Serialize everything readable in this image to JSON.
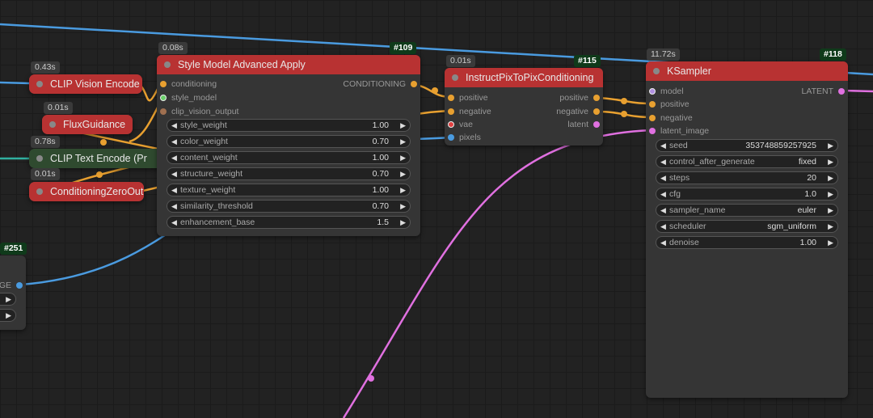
{
  "nodes": {
    "clip_vision_encode": {
      "title": "CLIP Vision Encode",
      "timing": "0.43s"
    },
    "flux_guidance": {
      "title": "FluxGuidance",
      "timing": "0.01s"
    },
    "clip_text_encode": {
      "title": "CLIP Text Encode (Pr",
      "timing": "0.78s"
    },
    "conditioning_zero_out": {
      "title": "ConditioningZeroOut",
      "timing": "0.01s"
    },
    "style_model": {
      "id": "#109",
      "title": "Style Model Advanced Apply",
      "timing": "0.08s",
      "inputs": [
        "conditioning",
        "style_model",
        "clip_vision_output"
      ],
      "output": "CONDITIONING",
      "widgets": [
        {
          "label": "style_weight",
          "value": "1.00"
        },
        {
          "label": "color_weight",
          "value": "0.70"
        },
        {
          "label": "content_weight",
          "value": "1.00"
        },
        {
          "label": "structure_weight",
          "value": "0.70"
        },
        {
          "label": "texture_weight",
          "value": "1.00"
        },
        {
          "label": "similarity_threshold",
          "value": "0.70"
        },
        {
          "label": "enhancement_base",
          "value": "1.5"
        }
      ]
    },
    "instruct_pix": {
      "id": "#115",
      "title": "InstructPixToPixConditioning",
      "timing": "0.01s",
      "inputs": [
        "positive",
        "negative",
        "vae",
        "pixels"
      ],
      "outputs": [
        "positive",
        "negative",
        "latent"
      ]
    },
    "ksampler": {
      "id": "#118",
      "title": "KSampler",
      "timing": "11.72s",
      "inputs": [
        "model",
        "positive",
        "negative",
        "latent_image"
      ],
      "output": "LATENT",
      "widgets": [
        {
          "label": "seed",
          "value": "353748859257925"
        },
        {
          "label": "control_after_generate",
          "value": "fixed"
        },
        {
          "label": "steps",
          "value": "20"
        },
        {
          "label": "cfg",
          "value": "1.0"
        },
        {
          "label": "sampler_name",
          "value": "euler"
        },
        {
          "label": "scheduler",
          "value": "sgm_uniform"
        },
        {
          "label": "denoise",
          "value": "1.00"
        }
      ]
    },
    "node251": {
      "id": "#251",
      "output_partial": "AGE"
    }
  },
  "colors": {
    "node_red": "#b83232",
    "node_green": "#2f4a2f",
    "node_body": "#353535",
    "wire_blue": "#4a9be0",
    "wire_orange": "#e8a030",
    "wire_pink": "#e070e0",
    "wire_teal": "#30b0a0",
    "badge_green": "#0f3a1a"
  },
  "icons": {
    "arrow_left": "◀",
    "arrow_right": "▶"
  }
}
